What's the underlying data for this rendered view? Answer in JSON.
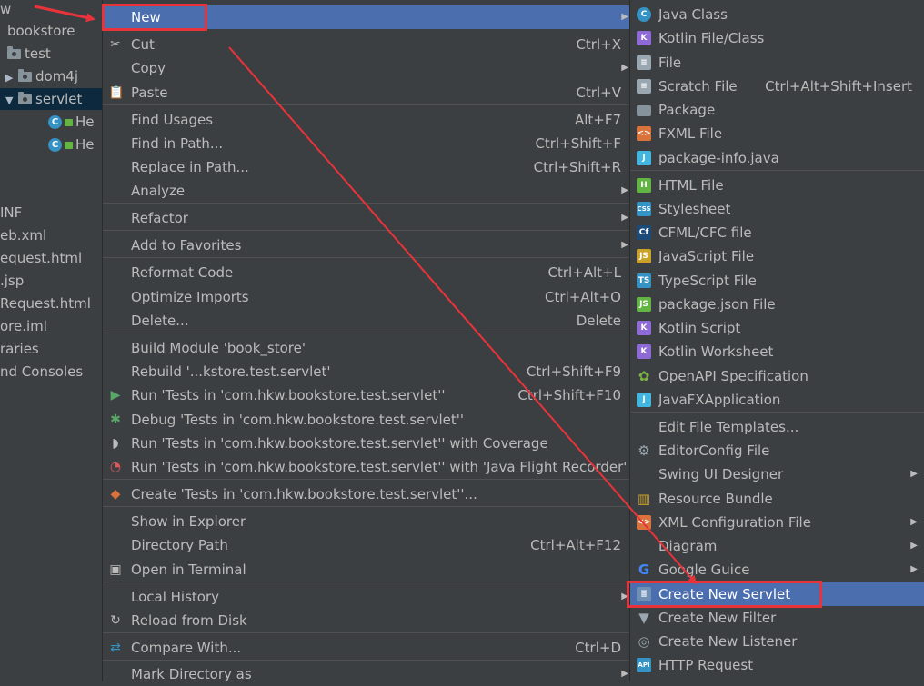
{
  "tree": [
    {
      "label": "w",
      "type": "text"
    },
    {
      "label": "bookstore",
      "type": "text"
    },
    {
      "label": "test",
      "type": "folder"
    },
    {
      "label": "dom4j",
      "type": "folder-collapsed"
    },
    {
      "label": "servlet",
      "type": "folder-expanded",
      "selected": true
    },
    {
      "label": "He",
      "type": "class"
    },
    {
      "label": "He",
      "type": "class"
    },
    {
      "label": "INF",
      "type": "text"
    },
    {
      "label": "eb.xml",
      "type": "text"
    },
    {
      "label": "equest.html",
      "type": "text"
    },
    {
      "label": ".jsp",
      "type": "text"
    },
    {
      "label": "Request.html",
      "type": "text"
    },
    {
      "label": "ore.iml",
      "type": "text"
    },
    {
      "label": "raries",
      "type": "text"
    },
    {
      "label": "nd Consoles",
      "type": "text"
    }
  ],
  "context_menu": [
    {
      "label": "New",
      "shortcut": "",
      "submenu": true,
      "selected": true,
      "icon": ""
    },
    {
      "label": "Cut",
      "shortcut": "Ctrl+X",
      "icon": "scissors-icon"
    },
    {
      "label": "Copy",
      "shortcut": "",
      "submenu": true,
      "icon": ""
    },
    {
      "label": "Paste",
      "shortcut": "Ctrl+V",
      "icon": "clipboard-icon"
    },
    {
      "label": "Find Usages",
      "shortcut": "Alt+F7",
      "icon": ""
    },
    {
      "label": "Find in Path...",
      "shortcut": "Ctrl+Shift+F",
      "icon": ""
    },
    {
      "label": "Replace in Path...",
      "shortcut": "Ctrl+Shift+R",
      "icon": ""
    },
    {
      "label": "Analyze",
      "shortcut": "",
      "submenu": true,
      "icon": ""
    },
    {
      "label": "Refactor",
      "shortcut": "",
      "submenu": true,
      "icon": ""
    },
    {
      "label": "Add to Favorites",
      "shortcut": "",
      "submenu": true,
      "icon": ""
    },
    {
      "label": "Reformat Code",
      "shortcut": "Ctrl+Alt+L",
      "icon": ""
    },
    {
      "label": "Optimize Imports",
      "shortcut": "Ctrl+Alt+O",
      "icon": ""
    },
    {
      "label": "Delete...",
      "shortcut": "Delete",
      "icon": ""
    },
    {
      "label": "Build Module 'book_store'",
      "shortcut": "",
      "icon": ""
    },
    {
      "label": "Rebuild '...kstore.test.servlet'",
      "shortcut": "Ctrl+Shift+F9",
      "icon": ""
    },
    {
      "label": "Run 'Tests in 'com.hkw.bookstore.test.servlet''",
      "shortcut": "Ctrl+Shift+F10",
      "icon": "run-icon"
    },
    {
      "label": "Debug 'Tests in 'com.hkw.bookstore.test.servlet''",
      "shortcut": "",
      "icon": "debug-icon"
    },
    {
      "label": "Run 'Tests in 'com.hkw.bookstore.test.servlet'' with Coverage",
      "shortcut": "",
      "icon": "coverage-icon"
    },
    {
      "label": "Run 'Tests in 'com.hkw.bookstore.test.servlet'' with 'Java Flight Recorder'",
      "shortcut": "",
      "icon": "profiler-icon"
    },
    {
      "label": "Create 'Tests in 'com.hkw.bookstore.test.servlet''...",
      "shortcut": "",
      "icon": "create-config-icon"
    },
    {
      "label": "Show in Explorer",
      "shortcut": "",
      "icon": ""
    },
    {
      "label": "Directory Path",
      "shortcut": "Ctrl+Alt+F12",
      "icon": ""
    },
    {
      "label": "Open in Terminal",
      "shortcut": "",
      "icon": "terminal-icon"
    },
    {
      "label": "Local History",
      "shortcut": "",
      "submenu": true,
      "icon": ""
    },
    {
      "label": "Reload from Disk",
      "shortcut": "",
      "icon": "reload-icon"
    },
    {
      "label": "Compare With...",
      "shortcut": "Ctrl+D",
      "icon": "compare-icon"
    },
    {
      "label": "Mark Directory as",
      "shortcut": "",
      "submenu": true,
      "icon": ""
    }
  ],
  "new_submenu": [
    {
      "label": "Java Class",
      "icon": "java-class-icon",
      "glyph": "C",
      "color": "#3592c4"
    },
    {
      "label": "Kotlin File/Class",
      "icon": "kotlin-file-icon",
      "glyph": "K",
      "color": "#8d6ad6"
    },
    {
      "label": "File",
      "icon": "file-icon",
      "glyph": "≡",
      "color": "#9aa7b0"
    },
    {
      "label": "Scratch File",
      "shortcut": "Ctrl+Alt+Shift+Insert",
      "icon": "scratch-file-icon",
      "glyph": "≡",
      "color": "#9aa7b0"
    },
    {
      "label": "Package",
      "icon": "package-icon",
      "glyph": "",
      "color": "#87939a"
    },
    {
      "label": "FXML File",
      "icon": "fxml-file-icon",
      "glyph": "<>",
      "color": "#d9733b"
    },
    {
      "label": "package-info.java",
      "icon": "package-info-icon",
      "glyph": "J",
      "color": "#40b6e0"
    },
    {
      "label": "HTML File",
      "icon": "html-file-icon",
      "glyph": "H",
      "color": "#62b543"
    },
    {
      "label": "Stylesheet",
      "icon": "css-file-icon",
      "glyph": "CSS",
      "color": "#3592c4"
    },
    {
      "label": "CFML/CFC file",
      "icon": "cfml-file-icon",
      "glyph": "Cf",
      "color": "#1c4b7a"
    },
    {
      "label": "JavaScript File",
      "icon": "js-file-icon",
      "glyph": "JS",
      "color": "#c9a227"
    },
    {
      "label": "TypeScript File",
      "icon": "ts-file-icon",
      "glyph": "TS",
      "color": "#3592c4"
    },
    {
      "label": "package.json File",
      "icon": "nodejs-icon",
      "glyph": "JS",
      "color": "#62b543"
    },
    {
      "label": "Kotlin Script",
      "icon": "kotlin-script-icon",
      "glyph": "K",
      "color": "#8d6ad6"
    },
    {
      "label": "Kotlin Worksheet",
      "icon": "kotlin-worksheet-icon",
      "glyph": "K",
      "color": "#8d6ad6"
    },
    {
      "label": "OpenAPI Specification",
      "icon": "openapi-icon",
      "glyph": "✿",
      "color": "#7cb342"
    },
    {
      "label": "JavaFXApplication",
      "icon": "javafx-icon",
      "glyph": "J",
      "color": "#40b6e0"
    },
    {
      "label": "Edit File Templates...",
      "icon": "",
      "glyph": "",
      "color": ""
    },
    {
      "label": "EditorConfig File",
      "icon": "gear-icon",
      "glyph": "⚙",
      "color": "#9aa7b0"
    },
    {
      "label": "Swing UI Designer",
      "icon": "",
      "glyph": "",
      "color": "",
      "submenu": true
    },
    {
      "label": "Resource Bundle",
      "icon": "resource-bundle-icon",
      "glyph": "▥",
      "color": "#c9a227"
    },
    {
      "label": "XML Configuration File",
      "icon": "xml-file-icon",
      "glyph": "<>",
      "color": "#d9733b",
      "submenu": true
    },
    {
      "label": "Diagram",
      "icon": "",
      "glyph": "",
      "color": "",
      "submenu": true
    },
    {
      "label": "Google Guice",
      "icon": "google-icon",
      "glyph": "G",
      "color": "#4285f4",
      "submenu": true
    },
    {
      "label": "Create New Servlet",
      "icon": "servlet-icon",
      "glyph": "≣",
      "color": "#6f8fb5",
      "selected": true
    },
    {
      "label": "Create New Filter",
      "icon": "filter-icon",
      "glyph": "▼",
      "color": "#9aa7b0"
    },
    {
      "label": "Create New Listener",
      "icon": "listener-icon",
      "glyph": "◎",
      "color": "#9aa7b0"
    },
    {
      "label": "HTTP Request",
      "icon": "api-icon",
      "glyph": "API",
      "color": "#3592c4"
    }
  ]
}
